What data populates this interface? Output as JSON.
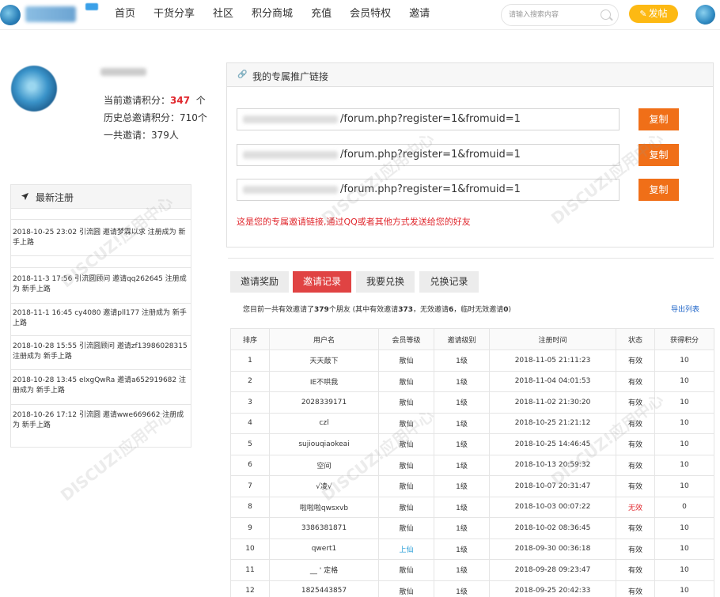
{
  "nav": {
    "items": [
      "首页",
      "干货分享",
      "社区",
      "积分商城",
      "充值",
      "会员特权",
      "邀请"
    ],
    "search_placeholder": "请输入搜索内容",
    "post_label": "发帖"
  },
  "profile": {
    "points_label": "当前邀请积分：",
    "points_value": "347",
    "points_unit": "个",
    "history_label": "历史总邀请积分：710个",
    "invited_label": "一共邀请：379人"
  },
  "recent": {
    "title": "最新注册",
    "rows": [
      "2018-10-25 23:02 引流圆 邀请梦霖以求 注册成为 新手上路",
      "2018-11-3 17:56 引流圆顾问 邀请qq262645 注册成为 新手上路",
      "2018-11-1 16:45 cy4080 邀请pll177 注册成为 新手上路",
      "2018-10-28 15:55 引流圆顾问 邀请zf13986028315 注册成为 新手上路",
      "2018-10-28 13:45 eIxgQwRa 邀请a652919682 注册成为 新手上路",
      "2018-10-26 17:12 引流圆 邀请wwe669662 注册成为 新手上路"
    ]
  },
  "link_panel": {
    "title": "我的专属推广链接",
    "link_suffix": "/forum.php?register=1&fromuid=1",
    "copy_label": "复制",
    "note": "这是您的专属邀请链接,通过QQ或者其他方式发送给您的好友"
  },
  "tabs": [
    "邀请奖励",
    "邀请记录",
    "我要兑换",
    "兑换记录"
  ],
  "summary": {
    "prefix": "您目前一共有效邀请了",
    "count": "379",
    "mid": "个朋友 (其中有效邀请",
    "valid": "373",
    "mid2": "，无效邀请",
    "invalid": "6",
    "mid3": "，临时无效邀请",
    "temp": "0",
    "suffix": ")",
    "export_label": "导出列表"
  },
  "table": {
    "headers": [
      "排序",
      "用户名",
      "会员等级",
      "邀请级别",
      "注册时间",
      "状态",
      "获得积分"
    ],
    "rows": [
      [
        "1",
        "天天敲下",
        "散仙",
        "1级",
        "2018-11-05 21:11:23",
        "有效",
        "10"
      ],
      [
        "2",
        "IE不哄我",
        "散仙",
        "1级",
        "2018-11-04 04:01:53",
        "有效",
        "10"
      ],
      [
        "3",
        "2028339171",
        "散仙",
        "1级",
        "2018-11-02 21:30:20",
        "有效",
        "10"
      ],
      [
        "4",
        "czl",
        "散仙",
        "1级",
        "2018-10-25 21:21:12",
        "有效",
        "10"
      ],
      [
        "5",
        "sujiouqiaokeai",
        "散仙",
        "1级",
        "2018-10-25 14:46:45",
        "有效",
        "10"
      ],
      [
        "6",
        "空间",
        "散仙",
        "1级",
        "2018-10-13 20:59:32",
        "有效",
        "10"
      ],
      [
        "7",
        "√凌√",
        "散仙",
        "1级",
        "2018-10-07 20:31:47",
        "有效",
        "10"
      ],
      [
        "8",
        "啦啦啦qwsxvb",
        "散仙",
        "1级",
        "2018-10-03 00:07:22",
        "无效",
        "0"
      ],
      [
        "9",
        "3386381871",
        "散仙",
        "1级",
        "2018-10-02 08:36:45",
        "有效",
        "10"
      ],
      [
        "10",
        "qwert1",
        "上仙",
        "1级",
        "2018-09-30 00:36:18",
        "有效",
        "10"
      ],
      [
        "11",
        "__ ' 定格",
        "散仙",
        "1级",
        "2018-09-28 09:23:47",
        "有效",
        "10"
      ],
      [
        "12",
        "1825443857",
        "散仙",
        "1级",
        "2018-09-25 20:42:33",
        "有效",
        "10"
      ]
    ]
  },
  "colors": {
    "accent_red": "#e0262c",
    "copy_orange": "#f06f18",
    "post_yellow": "#fdb913",
    "active_tab": "#e04343",
    "link_blue": "#1d64c8"
  }
}
